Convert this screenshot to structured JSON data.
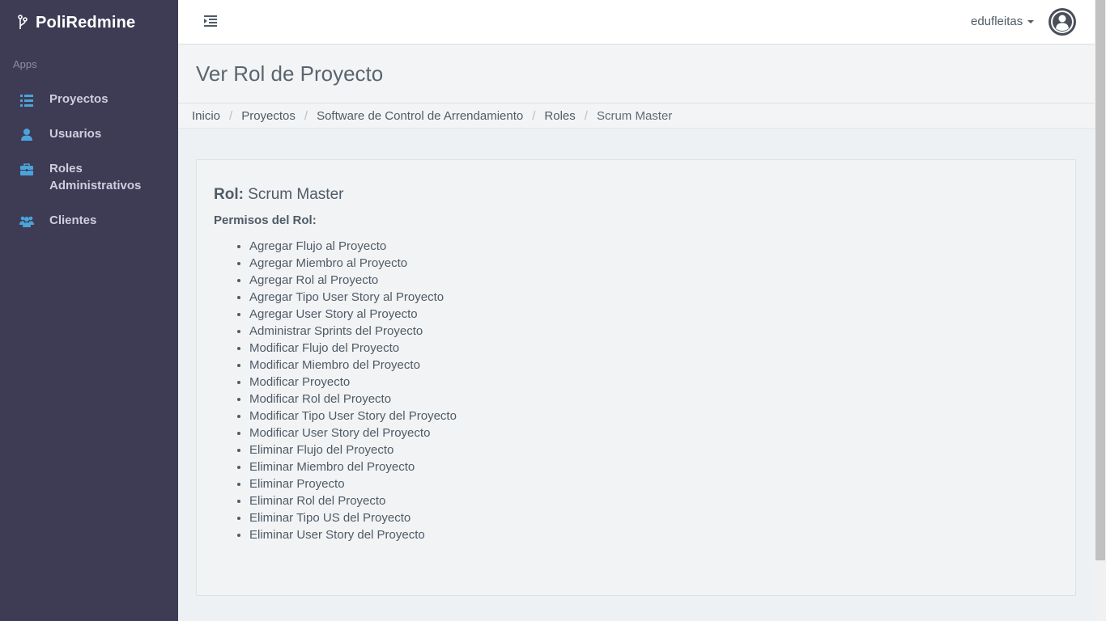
{
  "app": {
    "brand": "PoliRedmine",
    "apps_label": "Apps"
  },
  "sidebar": {
    "items": [
      {
        "label": "Proyectos",
        "icon": "list-icon"
      },
      {
        "label": "Usuarios",
        "icon": "user-icon"
      },
      {
        "label": "Roles Administrativos",
        "icon": "briefcase-icon"
      },
      {
        "label": "Clientes",
        "icon": "users-icon"
      }
    ]
  },
  "topbar": {
    "user_name": "edufleitas"
  },
  "page": {
    "title": "Ver Rol de Proyecto"
  },
  "breadcrumb": {
    "items": [
      "Inicio",
      "Proyectos",
      "Software de Control de Arrendamiento",
      "Roles",
      "Scrum Master"
    ],
    "separator": "/"
  },
  "role": {
    "label": "Rol:",
    "name": "Scrum Master",
    "permissions_heading": "Permisos del Rol:",
    "permissions": [
      "Agregar Flujo al Proyecto",
      "Agregar Miembro al Proyecto",
      "Agregar Rol al Proyecto",
      "Agregar Tipo User Story al Proyecto",
      "Agregar User Story al Proyecto",
      "Administrar Sprints del Proyecto",
      "Modificar Flujo del Proyecto",
      "Modificar Miembro del Proyecto",
      "Modificar Proyecto",
      "Modificar Rol del Proyecto",
      "Modificar Tipo User Story del Proyecto",
      "Modificar User Story del Proyecto",
      "Eliminar Flujo del Proyecto",
      "Eliminar Miembro del Proyecto",
      "Eliminar Proyecto",
      "Eliminar Rol del Proyecto",
      "Eliminar Tipo US del Proyecto",
      "Eliminar User Story del Proyecto"
    ]
  },
  "colors": {
    "sidebar_bg": "#3e3c54",
    "accent_icon": "#4ba3d9",
    "page_bg": "#eef1f3"
  }
}
